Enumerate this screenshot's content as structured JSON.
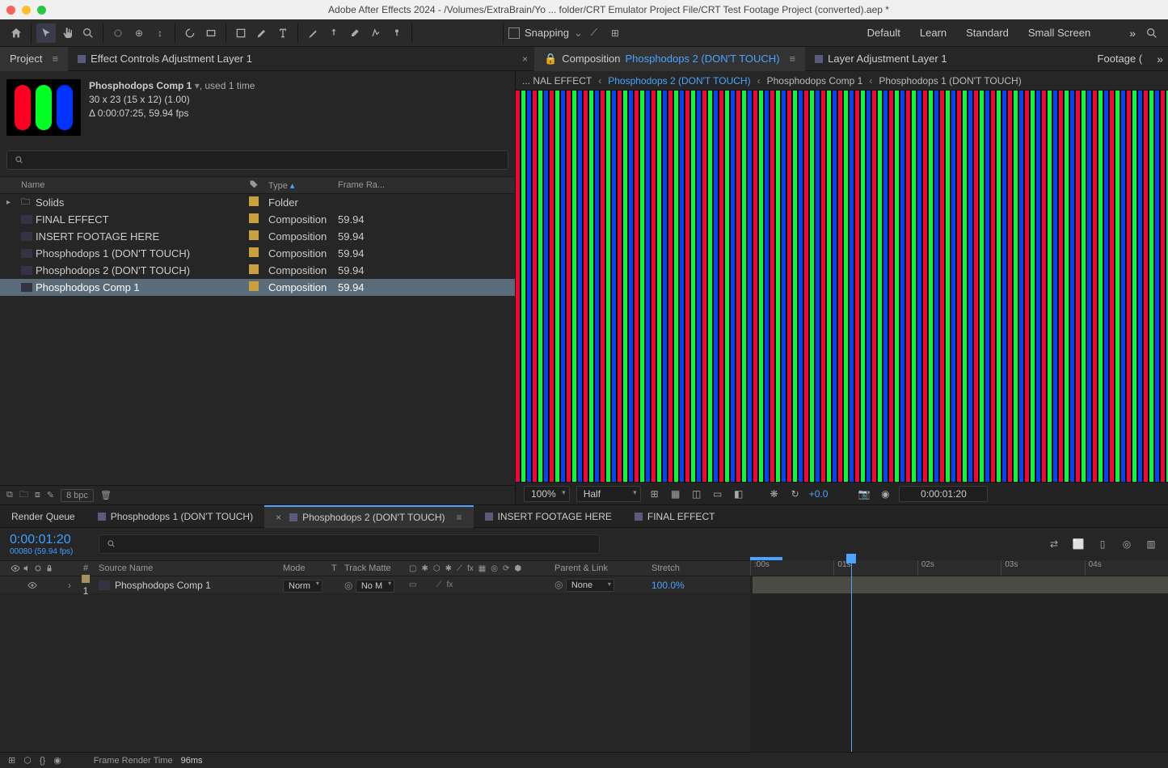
{
  "title": "Adobe After Effects 2024 - /Volumes/ExtraBrain/Yo ... folder/CRT Emulator Project File/CRT Test Footage Project (converted).aep *",
  "toolbar": {
    "snapping_label": "Snapping"
  },
  "workspaces": {
    "default": "Default",
    "learn": "Learn",
    "standard": "Standard",
    "smallscreen": "Small Screen"
  },
  "top_tabs": {
    "project": "Project",
    "effect_controls": "Effect Controls Adjustment Layer 1",
    "composition": "Composition",
    "comp_name": "Phosphodops 2 (DON'T TOUCH)",
    "layer": "Layer Adjustment Layer 1",
    "footage": "Footage ("
  },
  "breadcrumb": {
    "b0": "... NAL EFFECT",
    "b1": "Phosphodops 2 (DON'T TOUCH)",
    "b2": "Phosphodops Comp 1",
    "b3": "Phosphodops 1 (DON'T TOUCH)"
  },
  "proj_meta": {
    "name": "Phosphodops Comp 1",
    "used": ", used 1 time",
    "dims": "30 x 23  (15 x 12) (1.00)",
    "dur": "Δ 0:00:07:25, 59.94 fps"
  },
  "list_head": {
    "name": "Name",
    "type": "Type",
    "fr": "Frame Ra..."
  },
  "type_labels": {
    "folder": "Folder",
    "composition": "Composition"
  },
  "items": [
    {
      "name": "Solids",
      "type_key": "folder",
      "fr": "",
      "folder": true
    },
    {
      "name": "FINAL EFFECT",
      "type_key": "composition",
      "fr": "59.94"
    },
    {
      "name": "INSERT FOOTAGE HERE",
      "type_key": "composition",
      "fr": "59.94"
    },
    {
      "name": "Phosphodops 1 (DON'T TOUCH)",
      "type_key": "composition",
      "fr": "59.94"
    },
    {
      "name": "Phosphodops 2 (DON'T TOUCH)",
      "type_key": "composition",
      "fr": "59.94"
    },
    {
      "name": "Phosphodops Comp 1",
      "type_key": "composition",
      "fr": "59.94",
      "sel": true
    }
  ],
  "proj_foot": {
    "bpc": "8 bpc"
  },
  "viewer_foot": {
    "zoom": "100%",
    "res": "Half",
    "plus": "+0.0",
    "tc": "0:00:01:20"
  },
  "tl_tabs": {
    "rq": "Render Queue",
    "t0": "Phosphodops 1 (DON'T TOUCH)",
    "t1": "Phosphodops 2 (DON'T TOUCH)",
    "t2": "INSERT FOOTAGE HERE",
    "t3": "FINAL EFFECT"
  },
  "tl": {
    "tc": "0:00:01:20",
    "info": "00080 (59.94 fps)",
    "cols": {
      "source": "Source Name",
      "mode": "Mode",
      "t": "T",
      "track": "Track Matte",
      "parent": "Parent & Link",
      "stretch": "Stretch"
    },
    "layer": {
      "idx": "1",
      "name": "Phosphodops Comp 1",
      "mode": "Norm",
      "track": "No M",
      "parent": "None",
      "stretch": "100.0%"
    }
  },
  "ruler": {
    "t0": ":00s",
    "t1": "01s",
    "t2": "02s",
    "t3": "03s",
    "t4": "04s"
  },
  "foot": {
    "label": "Frame Render Time",
    "val": "96ms"
  }
}
